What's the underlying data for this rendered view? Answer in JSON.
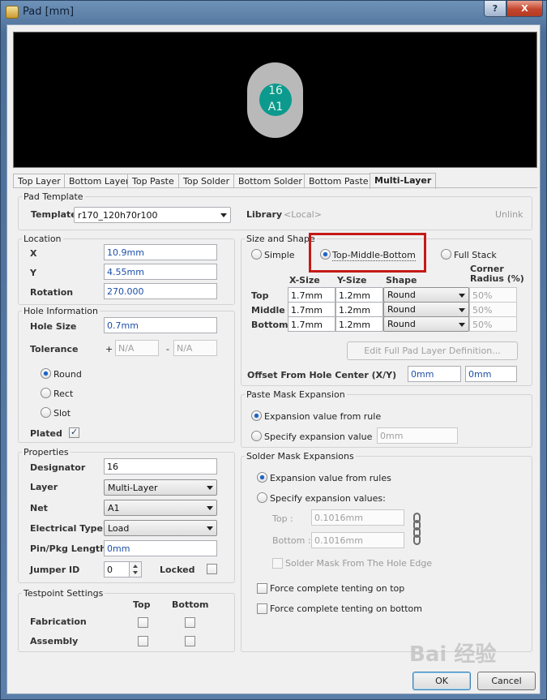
{
  "window": {
    "title": "Pad [mm]",
    "help": "?",
    "close": "X"
  },
  "preview": {
    "designator": "16",
    "net": "A1"
  },
  "tabs": [
    "Top Layer",
    "Bottom Layer",
    "Top Paste",
    "Top Solder",
    "Bottom Solder",
    "Bottom Paste",
    "Multi-Layer"
  ],
  "pad_template": {
    "group": "Pad Template",
    "template_label": "Template",
    "template_value": "r170_120h70r100",
    "library_label": "Library",
    "library_value": "<Local>",
    "unlink": "Unlink"
  },
  "location": {
    "group": "Location",
    "x_label": "X",
    "x": "10.9mm",
    "y_label": "Y",
    "y": "4.55mm",
    "rotation_label": "Rotation",
    "rotation": "270.000"
  },
  "hole": {
    "group": "Hole Information",
    "size_label": "Hole Size",
    "size": "0.7mm",
    "tolerance_label": "Tolerance",
    "plus": "+",
    "minus": "-",
    "tol_plus": "N/A",
    "tol_minus": "N/A",
    "round": "Round",
    "rect": "Rect",
    "slot": "Slot",
    "plated": "Plated",
    "selected": "Round",
    "plated_checked": true
  },
  "properties": {
    "group": "Properties",
    "designator_label": "Designator",
    "designator": "16",
    "layer_label": "Layer",
    "layer": "Multi-Layer",
    "net_label": "Net",
    "net": "A1",
    "etype_label": "Electrical Type",
    "etype": "Load",
    "pinpkg_label": "Pin/Pkg Length",
    "pinpkg": "0mm",
    "jumper_label": "Jumper ID",
    "jumper": "0",
    "locked_label": "Locked"
  },
  "testpoint": {
    "group": "Testpoint Settings",
    "top": "Top",
    "bottom": "Bottom",
    "fabrication": "Fabrication",
    "assembly": "Assembly"
  },
  "size_shape": {
    "group": "Size and Shape",
    "simple": "Simple",
    "tmb": "Top-Middle-Bottom",
    "full": "Full Stack",
    "selected": "Top-Middle-Bottom",
    "col_x": "X-Size",
    "col_y": "Y-Size",
    "col_shape": "Shape",
    "col_corner": "Corner\nRadius (%)",
    "rows": [
      {
        "label": "Top",
        "x": "1.7mm",
        "y": "1.2mm",
        "shape": "Round",
        "corner": "50%"
      },
      {
        "label": "Middle",
        "x": "1.7mm",
        "y": "1.2mm",
        "shape": "Round",
        "corner": "50%"
      },
      {
        "label": "Bottom",
        "x": "1.7mm",
        "y": "1.2mm",
        "shape": "Round",
        "corner": "50%"
      }
    ],
    "edit_button": "Edit Full Pad Layer Definition...",
    "offset_label": "Offset From Hole Center (X/Y)",
    "offset_x": "0mm",
    "offset_y": "0mm"
  },
  "paste_mask": {
    "group": "Paste Mask Expansion",
    "from_rule": "Expansion value from rule",
    "specify": "Specify expansion value",
    "value": "0mm"
  },
  "solder_mask": {
    "group": "Solder Mask Expansions",
    "from_rules": "Expansion value from rules",
    "specify": "Specify expansion values:",
    "top_label": "Top :",
    "top": "0.1016mm",
    "bottom_label": "Bottom :",
    "bottom": "0.1016mm",
    "from_hole_edge": "Solder Mask From The Hole Edge",
    "tent_top": "Force complete tenting on top",
    "tent_bottom": "Force complete tenting on bottom"
  },
  "buttons": {
    "ok": "OK",
    "cancel": "Cancel"
  },
  "watermark": "Bai 经验"
}
